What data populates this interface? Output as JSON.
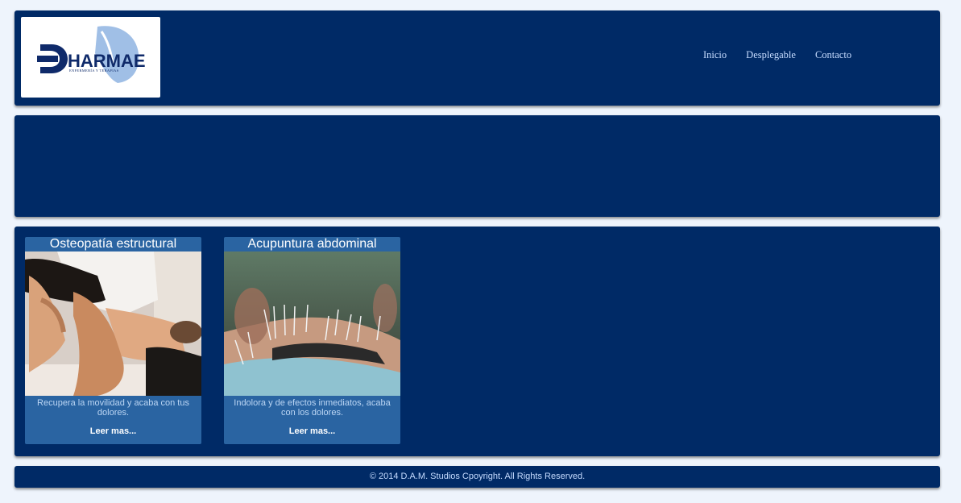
{
  "header": {
    "logo": {
      "text": "HARMAE",
      "subtitle": "ENFERMERÍA Y TERAPIAS"
    },
    "nav": [
      {
        "label": "Inicio"
      },
      {
        "label": "Desplegable"
      },
      {
        "label": "Contacto"
      }
    ]
  },
  "cards": [
    {
      "title": "Osteopatía estructural",
      "description": "Recupera la movilidad y acaba con tus dolores.",
      "link": "Leer mas...",
      "image": "osteopathy-photo"
    },
    {
      "title": "Acupuntura abdominal",
      "description": "Indolora y de efectos inmediatos, acaba con los dolores.",
      "link": "Leer mas...",
      "image": "acupuncture-photo"
    }
  ],
  "footer": {
    "copyright": "© 2014 D.A.M. Studios Cpoyright. All Rights Reserved."
  },
  "colors": {
    "panel": "#002a66",
    "card": "#2a64a2",
    "background": "#eef4fc"
  }
}
